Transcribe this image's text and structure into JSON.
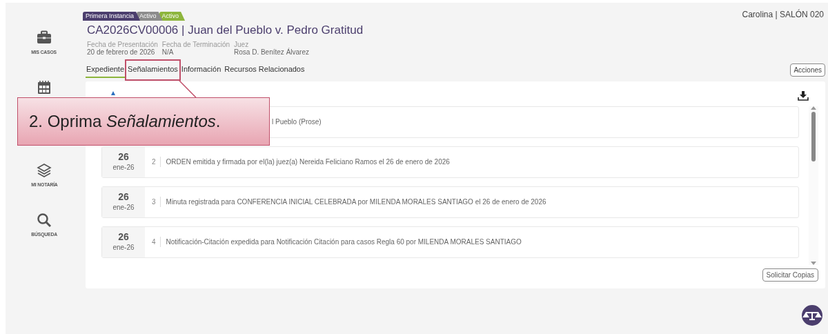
{
  "sidebar": {
    "items": [
      {
        "kind": "labeled",
        "label": "MIS CASOS"
      },
      {
        "kind": "icon_only"
      },
      {
        "kind": "labeled",
        "label": "MI NOTARÍA"
      },
      {
        "kind": "labeled",
        "label": "BÚSQUEDA"
      }
    ]
  },
  "user": "Carolina | SALÓN 020",
  "badges": [
    {
      "label": "Primera Instancia",
      "color": "#4b3e6d"
    },
    {
      "label": "Activo",
      "color": "#8c8c8c"
    },
    {
      "label": "Activo",
      "color": "#8db53c"
    }
  ],
  "case_title": "CA2026CV00006 | Juan del Pueblo v. Pedro Gratitud",
  "meta": [
    {
      "label": "Fecha de Presentación",
      "value": "20 de febrero de 2026"
    },
    {
      "label": "Fecha de Terminación",
      "value": "N/A"
    },
    {
      "label": "Juez",
      "value": "Rosa D. Benítez Álvarez"
    }
  ],
  "tabs": [
    {
      "label": "Expediente",
      "selected": true
    },
    {
      "label": "Señalamientos",
      "selected": false
    },
    {
      "label": "Información",
      "selected": false
    },
    {
      "label": "Recursos Relacionados",
      "selected": false
    }
  ],
  "actions_button": "Acciones",
  "entries": [
    {
      "text": "l Pueblo (Prose)"
    },
    {
      "day": "26",
      "month": "ene",
      "year": "-26",
      "number": "2",
      "text": "ORDEN emitida y firmada por el(la) juez(a) Nereida Feliciano Ramos el 26 de enero de 2026"
    },
    {
      "day": "26",
      "month": "ene",
      "year": "-26",
      "number": "3",
      "text": "Minuta registrada para CONFERENCIA INICIAL CELEBRADA por MILENDA MORALES SANTIAGO el 26 de enero de 2026"
    },
    {
      "day": "26",
      "month": "ene",
      "year": "-26",
      "number": "4",
      "text": "Notificación-Citación expedida para Notificación Citación para casos Regla 60 por MILENDA MORALES SANTIAGO"
    }
  ],
  "copies_button": "Solicitar Copias",
  "callout": {
    "text": "2. Oprima *Señalamientos*."
  }
}
